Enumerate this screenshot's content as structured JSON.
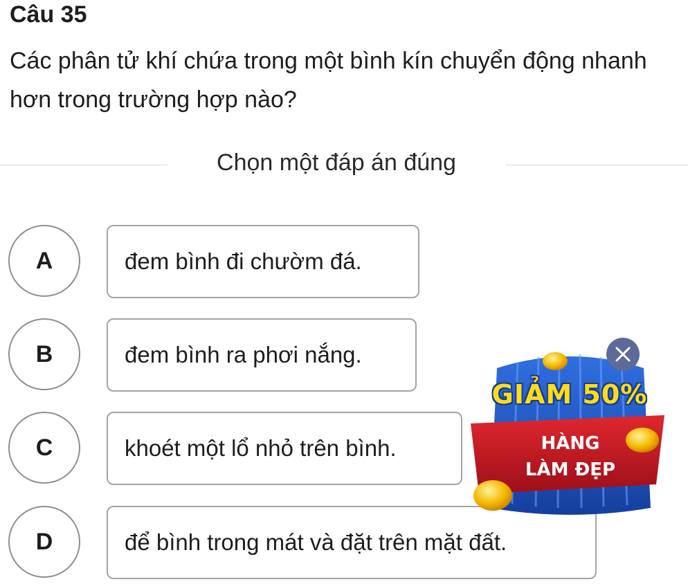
{
  "question": {
    "number": "Câu 35",
    "text": "Các phân tử khí chứa trong một bình kín chuyển động nhanh hơn trong trường hợp nào?"
  },
  "instruction": "Chọn một đáp án đúng",
  "options": [
    {
      "letter": "A",
      "text": "đem bình đi chườm đá."
    },
    {
      "letter": "B",
      "text": "đem bình ra phơi nắng."
    },
    {
      "letter": "C",
      "text": "khoét một lổ nhỏ trên bình."
    },
    {
      "letter": "D",
      "text": "để bình trong mát và đặt trên mặt đất."
    }
  ],
  "ad": {
    "headline": "GIẢM 50%",
    "line1": "HÀNG",
    "line2": "LÀM ĐẸP",
    "close_icon": "close-icon",
    "colors": {
      "blue": "#1f4fb6",
      "red": "#c1121f",
      "yellow": "#ffdc1a",
      "close_bg": "#5d6a9a"
    }
  }
}
